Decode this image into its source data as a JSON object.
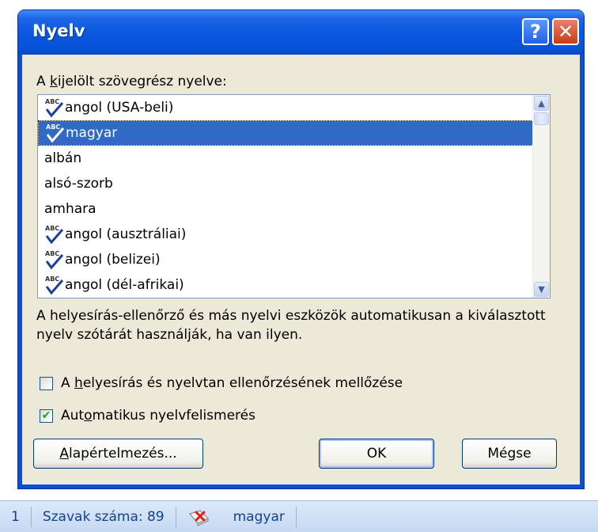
{
  "dialog": {
    "title": "Nyelv",
    "help_label": "?",
    "close_label": "✕",
    "list_label_prefix": "A ",
    "list_label_accel": "k",
    "list_label_rest": "ijelölt szövegrész nyelve:",
    "languages": [
      {
        "name": "angol (USA-beli)",
        "spell": true,
        "selected": false
      },
      {
        "name": "magyar",
        "spell": true,
        "selected": true
      },
      {
        "name": "albán",
        "spell": false,
        "selected": false
      },
      {
        "name": "alsó-szorb",
        "spell": false,
        "selected": false
      },
      {
        "name": "amhara",
        "spell": false,
        "selected": false
      },
      {
        "name": "angol (ausztráliai)",
        "spell": true,
        "selected": false
      },
      {
        "name": "angol (belizei)",
        "spell": true,
        "selected": false
      },
      {
        "name": "angol (dél-afrikai)",
        "spell": true,
        "selected": false
      }
    ],
    "description": "A helyesírás-ellenőrző és más nyelvi eszközök automatikusan a kiválasztott nyelv szótárát használják, ha van ilyen.",
    "skip_check": {
      "prefix": "A ",
      "accel": "h",
      "rest": "elyesírás és nyelvtan ellenőrzésének mellőzése",
      "checked": false
    },
    "auto_detect": {
      "prefix": "Aut",
      "accel": "o",
      "rest": "matikus nyelvfelismerés",
      "checked": true
    },
    "default_button": {
      "accel": "A",
      "rest": "lapértelmezés..."
    },
    "ok_label": "OK",
    "cancel_label": "Mégse"
  },
  "statusbar": {
    "page": "1",
    "word_count": "Szavak száma: 89",
    "language": "magyar"
  },
  "colors": {
    "title_blue": "#0a57e0",
    "selection": "#316ac5",
    "face": "#ece9d8"
  }
}
